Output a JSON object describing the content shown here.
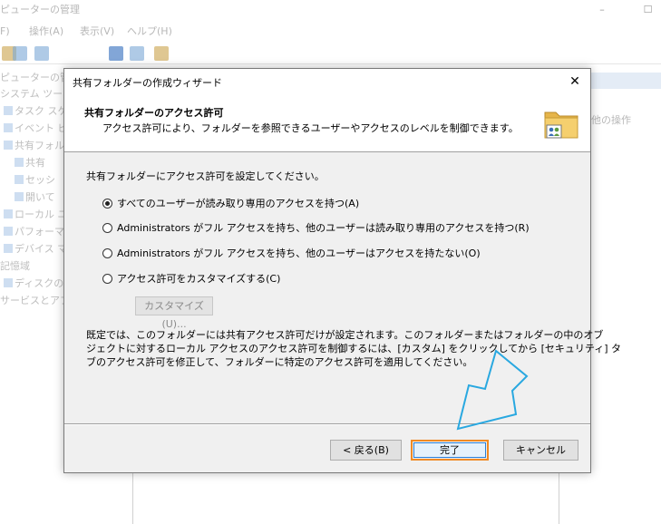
{
  "background": {
    "title_fragment": "ピューターの管理",
    "menu": [
      "F)",
      "操作(A)",
      "表示(V)",
      "ヘルプ(H)"
    ],
    "tree": [
      "ピューターの管理",
      "システム ツール",
      "タスク スケ",
      "イベント ビ",
      "共有フォル",
      "共有",
      "セッシ",
      "開いて",
      "ローカル ユー",
      "パフォーマン",
      "デバイス マ",
      "記憶域",
      "ディスクの管",
      "サービスとアプリ"
    ],
    "right_panel_text": "他の操作"
  },
  "dialog": {
    "title": "共有フォルダーの作成ウィザード",
    "close_glyph": "✕",
    "header_title": "共有フォルダーのアクセス許可",
    "header_subtitle": "アクセス許可により、フォルダーを参照できるユーザーやアクセスのレベルを制御できます。",
    "prompt": "共有フォルダーにアクセス許可を設定してください。",
    "options": [
      {
        "label": "すべてのユーザーが読み取り専用のアクセスを持つ(A)",
        "selected": true
      },
      {
        "label": "Administrators がフル アクセスを持ち、他のユーザーは読み取り専用のアクセスを持つ(R)",
        "selected": false
      },
      {
        "label": "Administrators がフル アクセスを持ち、他のユーザーはアクセスを持たない(O)",
        "selected": false
      },
      {
        "label": "アクセス許可をカスタマイズする(C)",
        "selected": false
      }
    ],
    "customize_button": "カスタマイズ(U)...",
    "info_lines": [
      "既定では、このフォルダーには共有アクセス許可だけが設定されます。このフォルダーまたはフォルダーの中のオブ",
      "ジェクトに対するローカル アクセスのアクセス許可を制御するには、[カスタム] をクリックしてから [セキュリティ] タ",
      "ブのアクセス許可を修正して、フォルダーに特定のアクセス許可を適用してください。"
    ],
    "buttons": {
      "back": "< 戻る(B)",
      "finish": "完了",
      "cancel": "キャンセル"
    }
  },
  "colors": {
    "finish_highlight": "#f08a24",
    "arrow": "#29a8e0"
  }
}
